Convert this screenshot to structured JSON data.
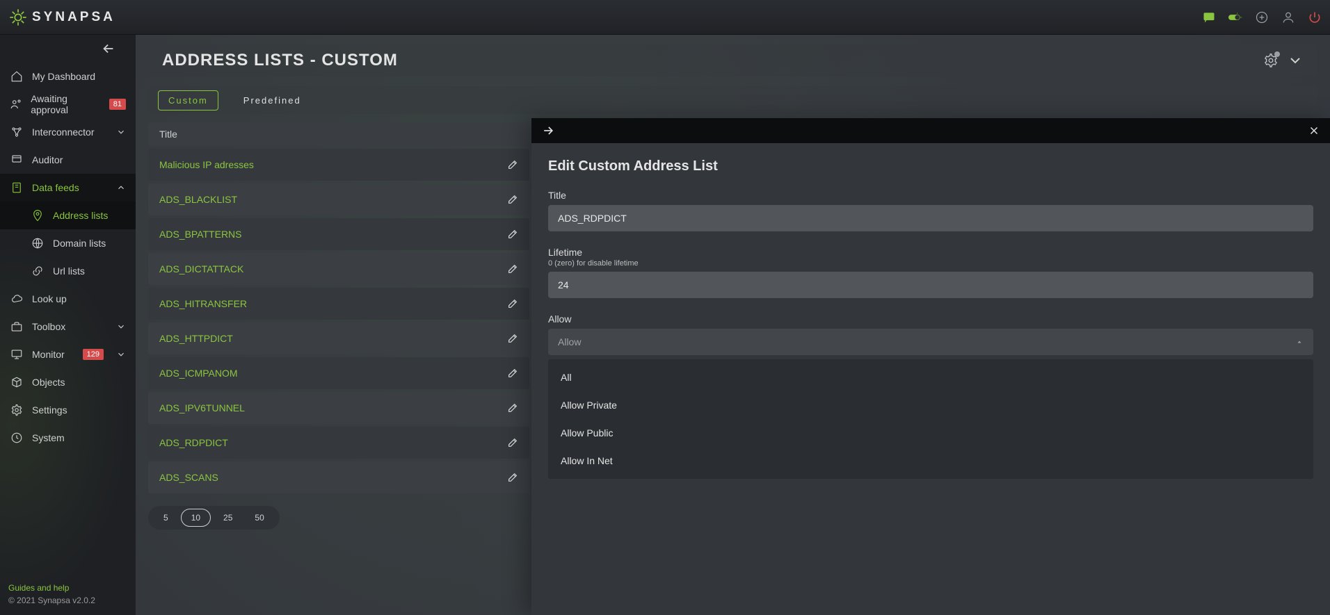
{
  "brand": "SYNAPSA",
  "header": {
    "title": "ADDRESS LISTS - CUSTOM"
  },
  "tabs": {
    "custom": "Custom",
    "predefined": "Predefined"
  },
  "sidebar": {
    "items": [
      {
        "icon": "home",
        "label": "My Dashboard"
      },
      {
        "icon": "approval",
        "label": "Awaiting approval",
        "badge": "81"
      },
      {
        "icon": "interconnector",
        "label": "Interconnector",
        "chev": true
      },
      {
        "icon": "auditor",
        "label": "Auditor"
      },
      {
        "icon": "datafeeds",
        "label": "Data feeds",
        "chev": true,
        "expanded": true
      },
      {
        "icon": "pin",
        "label": "Address lists",
        "sub": true,
        "active": true
      },
      {
        "icon": "globe",
        "label": "Domain lists",
        "sub": true
      },
      {
        "icon": "link",
        "label": "Url lists",
        "sub": true
      },
      {
        "icon": "cloud",
        "label": "Look up"
      },
      {
        "icon": "toolbox",
        "label": "Toolbox",
        "chev": true
      },
      {
        "icon": "monitor",
        "label": "Monitor",
        "badge": "129",
        "chev": true
      },
      {
        "icon": "objects",
        "label": "Objects"
      },
      {
        "icon": "settings",
        "label": "Settings"
      },
      {
        "icon": "system",
        "label": "System"
      }
    ]
  },
  "list": {
    "header": "Title",
    "rows": [
      "Malicious IP adresses",
      "ADS_BLACKLIST",
      "ADS_BPATTERNS",
      "ADS_DICTATTACK",
      "ADS_HITRANSFER",
      "ADS_HTTPDICT",
      "ADS_ICMPANOM",
      "ADS_IPV6TUNNEL",
      "ADS_RDPDICT",
      "ADS_SCANS"
    ]
  },
  "pager": {
    "options": [
      "5",
      "10",
      "25",
      "50"
    ],
    "active": "10"
  },
  "panel": {
    "heading": "Edit Custom Address List",
    "title_label": "Title",
    "title_value": "ADS_RDPDICT",
    "lifetime_label": "Lifetime",
    "lifetime_hint": "0 (zero) for disable lifetime",
    "lifetime_value": "24",
    "allow_label": "Allow",
    "allow_placeholder": "Allow",
    "options": [
      "All",
      "Allow Private",
      "Allow Public",
      "Allow In Net"
    ]
  },
  "footer": {
    "help": "Guides and help",
    "copyright": "© 2021 Synapsa v2.0.2"
  }
}
